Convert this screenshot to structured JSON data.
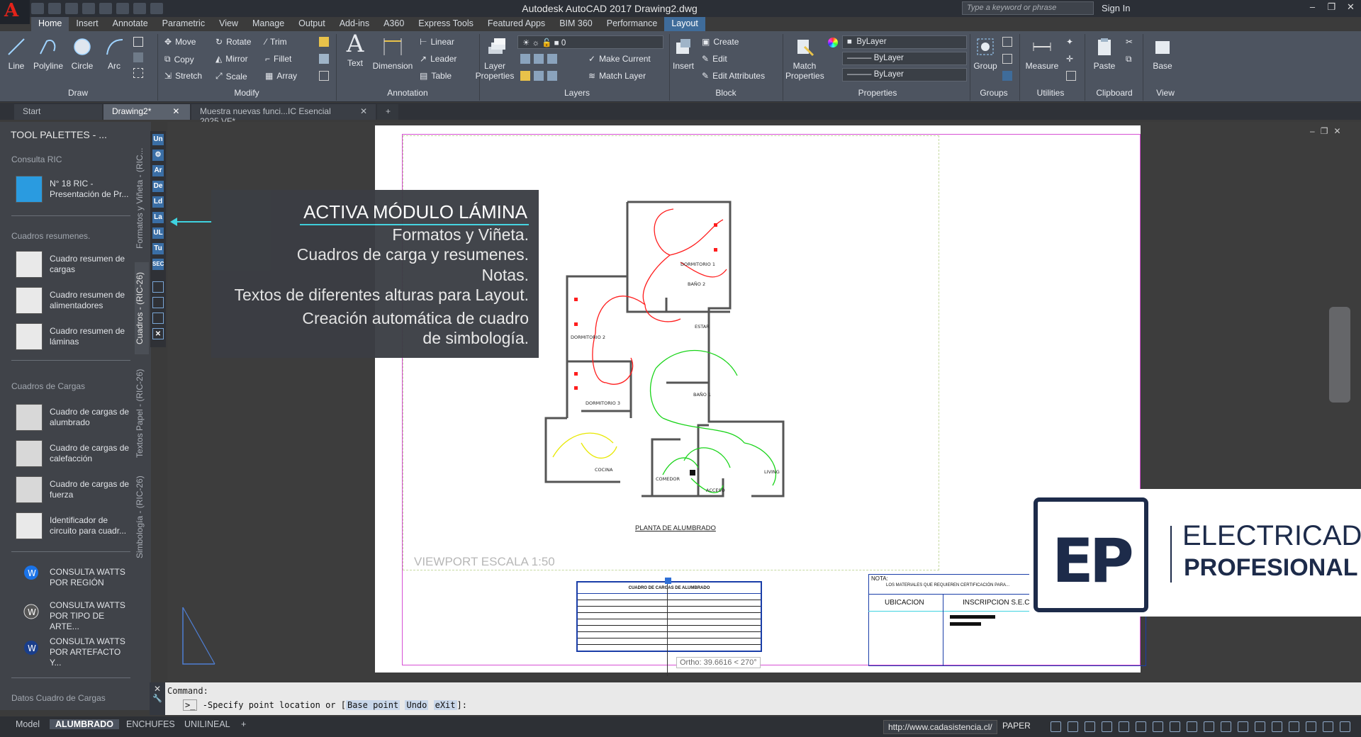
{
  "app": {
    "title": "Autodesk AutoCAD 2017    Drawing2.dwg",
    "search_placeholder": "Type a keyword or phrase",
    "sign_in": "Sign In"
  },
  "ribbon_tabs": [
    "Home",
    "Insert",
    "Annotate",
    "Parametric",
    "View",
    "Manage",
    "Output",
    "Add-ins",
    "A360",
    "Express Tools",
    "Featured Apps",
    "BIM 360",
    "Performance",
    "Layout"
  ],
  "draw": {
    "line": "Line",
    "polyline": "Polyline",
    "circle": "Circle",
    "arc": "Arc",
    "panel": "Draw"
  },
  "modify": {
    "move": "Move",
    "rotate": "Rotate",
    "trim": "Trim",
    "copy": "Copy",
    "mirror": "Mirror",
    "fillet": "Fillet",
    "stretch": "Stretch",
    "scale": "Scale",
    "array": "Array",
    "panel": "Modify"
  },
  "annotation": {
    "text": "Text",
    "dimension": "Dimension",
    "linear": "Linear",
    "leader": "Leader",
    "table": "Table",
    "panel": "Annotation"
  },
  "layers": {
    "layer_properties": "Layer Properties",
    "current_layer": "0",
    "make_current": "Make Current",
    "match_layer": "Match Layer",
    "panel": "Layers"
  },
  "block": {
    "insert": "Insert",
    "create": "Create",
    "edit": "Edit",
    "edit_attributes": "Edit Attributes",
    "panel": "Block"
  },
  "properties": {
    "match": "Match Properties",
    "color": "ByLayer",
    "linetype": "ByLayer",
    "lineweight": "ByLayer",
    "panel": "Properties"
  },
  "groups": {
    "group": "Group",
    "panel": "Groups"
  },
  "utilities": {
    "measure": "Measure",
    "panel": "Utilities"
  },
  "clipboard": {
    "paste": "Paste",
    "panel": "Clipboard"
  },
  "view": {
    "base": "Base",
    "panel": "View"
  },
  "file_tabs": [
    {
      "label": "Start"
    },
    {
      "label": "Drawing2*"
    },
    {
      "label": "Muestra nuevas funci...IC Esencial 2025 VF*"
    }
  ],
  "palette": {
    "title": "TOOL PALETTES - ...",
    "sections": {
      "consulta_ric": "Consulta RIC",
      "cuadros_resumenes": "Cuadros resumenes.",
      "cuadros_cargas": "Cuadros de Cargas",
      "datos": "Datos Cuadro de Cargas"
    },
    "items": {
      "ric18": "N° 18 RIC - Presentación de Pr...",
      "resumen_cargas": "Cuadro resumen de cargas",
      "resumen_alim": "Cuadro resumen de alimentadores",
      "resumen_laminas": "Cuadro resumen de láminas",
      "cargas_alumbrado": "Cuadro de cargas de alumbrado",
      "cargas_calefaccion": "Cuadro de cargas de calefacción",
      "cargas_fuerza": "Cuadro de cargas de fuerza",
      "identificador": "Identificador de circuito para cuadr...",
      "watts_region": "CONSULTA WATTS POR REGIÓN",
      "watts_tipo": "CONSULTA WATTS POR TIPO DE ARTE...",
      "watts_artefacto": "CONSULTA WATTS POR ARTEFACTO Y..."
    },
    "vtabs": [
      "Formatos y Viñeta - (RIC...",
      "Cuadros - (RIC-26)",
      "Textos Papel - (RIC-26)",
      "Simbología - (RIC-26)"
    ],
    "side_buttons": [
      "Un",
      "Ar",
      "De",
      "Ld",
      "La",
      "UL",
      "Tu",
      "SEC"
    ]
  },
  "tooltip": {
    "title": "ACTIVA MÓDULO LÁMINA",
    "lines": [
      "Formatos y Viñeta.",
      "Cuadros de carga y resumenes.",
      "Notas.",
      "Textos de diferentes alturas para Layout.",
      "Creación automática de cuadro",
      "de simbología."
    ]
  },
  "drawing": {
    "viewport_scale": "VIEWPORT ESCALA 1:50",
    "plan_title": "PLANTA DE ALUMBRADO",
    "rooms": [
      "DORMITORIO 1",
      "BAÑO 2",
      "ESTAR",
      "DORMITORIO 2",
      "BAÑO 1",
      "DORMITORIO 3",
      "COCINA",
      "COMEDOR",
      "ACCESO",
      "LIVING"
    ],
    "nota_label": "NOTA:",
    "nota_text": "LOS MATERIALES QUE REQUIEREN CERTIFICACIÓN PARA...",
    "ubicacion": "UBICACION",
    "inscripcion": "INSCRIPCION S.E.C.",
    "table_title": "CUADRO DE CARGAS DE ALUMBRADO",
    "ortho": "Ortho: 39.6616 < 270°"
  },
  "logo": {
    "letters": "EP",
    "line1": "ELECTRICAD",
    "line2": "PROFESIONAL"
  },
  "command": {
    "label": "Command:",
    "prompt": "-Specify point location or [",
    "opt1": "Base point",
    "opt2": "Undo",
    "opt3": "eXit",
    "end": "]:"
  },
  "status": {
    "tabs": [
      "Model",
      "ALUMBRADO",
      "ENCHUFES",
      "UNILINEAL"
    ],
    "url": "http://www.cadasistencia.cl/",
    "paper": "PAPER"
  },
  "colors": {
    "accent": "#3fd3e0",
    "red_circuit": "#ff1d1d",
    "green_circuit": "#19d419",
    "yellow_circuit": "#e8e800",
    "brand": "#1d2b4a"
  }
}
